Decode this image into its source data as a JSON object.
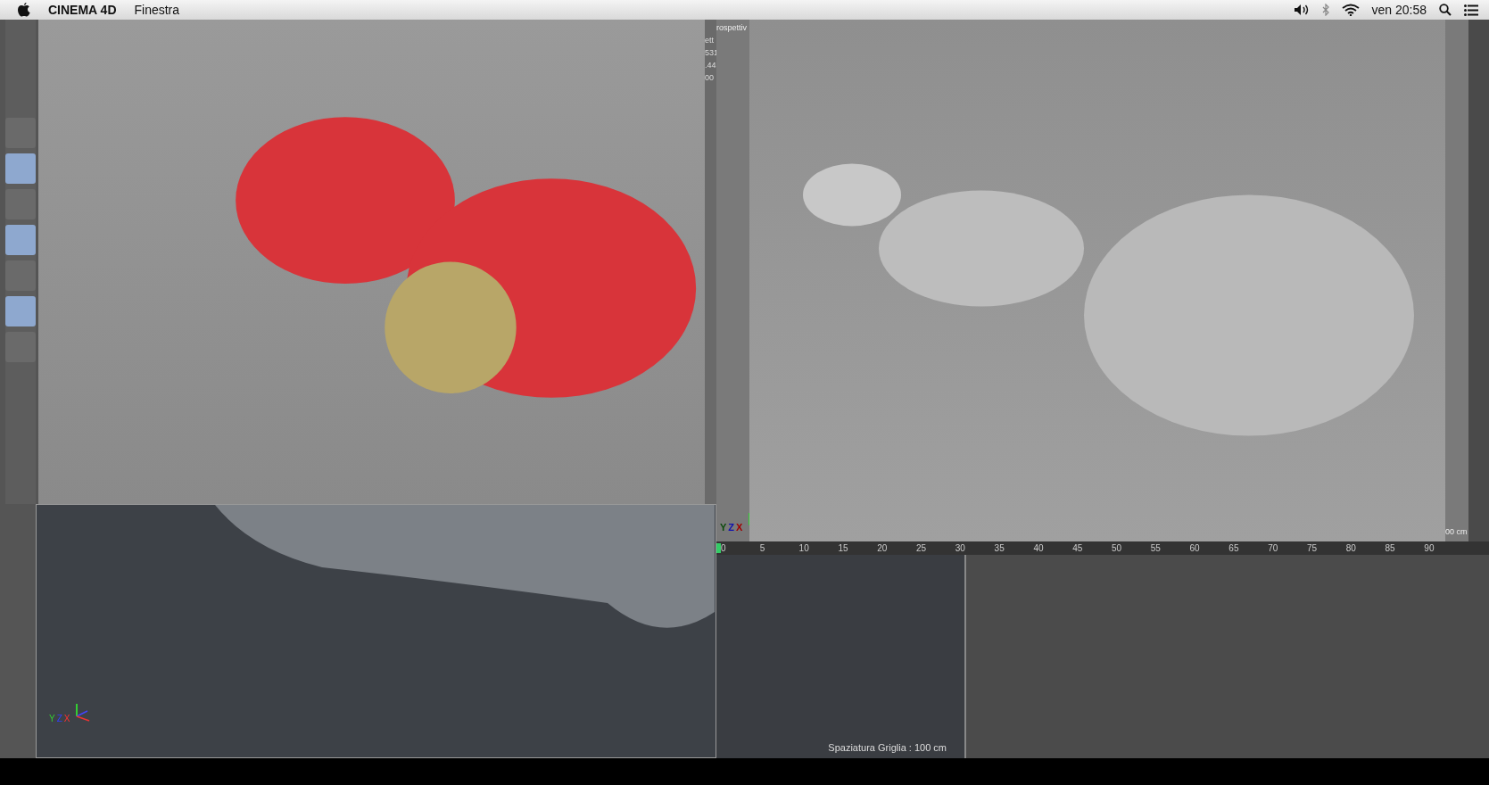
{
  "menu_bar": {
    "app_name": "CINEMA 4D",
    "menus": [
      "Finestra"
    ],
    "clock": "ven 20:58"
  },
  "left_toolbar": [
    {
      "selected": false
    },
    {
      "selected": true
    },
    {
      "selected": false
    },
    {
      "selected": true
    },
    {
      "selected": false
    },
    {
      "selected": true
    },
    {
      "selected": false
    }
  ],
  "left_viewport": {
    "side_labels": [
      "ett",
      "531",
      ".44",
      "00"
    ]
  },
  "left_lower_viewport": {
    "axes": [
      "Y",
      "Z",
      "X"
    ]
  },
  "right_viewport": {
    "title": "rospettiv",
    "axes": [
      "Y",
      "Z",
      "X"
    ],
    "corner_label": "00 cm"
  },
  "timeline": {
    "ticks": [
      "0",
      "5",
      "10",
      "15",
      "20",
      "25",
      "30",
      "35",
      "40",
      "45",
      "50",
      "55",
      "60",
      "65",
      "70",
      "75",
      "80",
      "85",
      "90"
    ]
  },
  "bottom_viewport": {
    "grid_spacing": "Spaziatura Griglia : 100 cm"
  }
}
